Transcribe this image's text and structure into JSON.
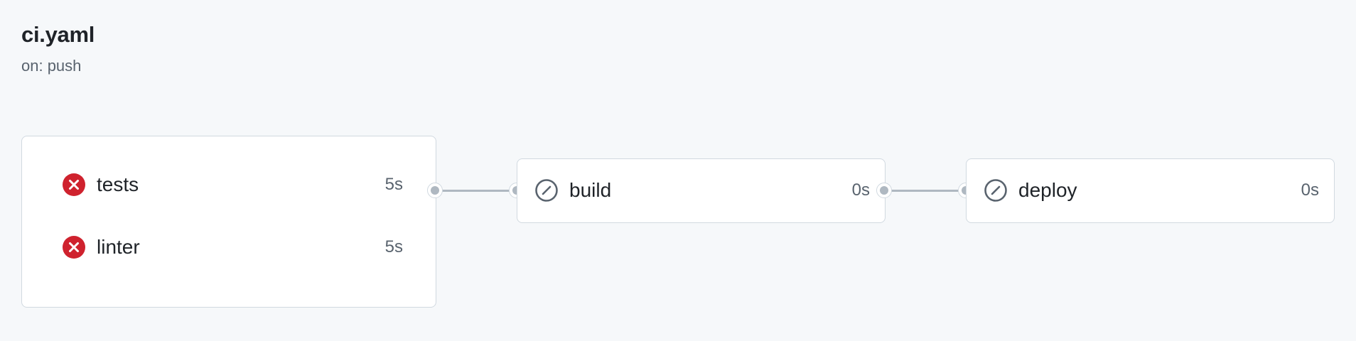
{
  "workflow": {
    "file_name": "ci.yaml",
    "trigger": "on: push"
  },
  "jobs": {
    "tests": {
      "name": "tests",
      "duration": "5s",
      "status": "failure",
      "icon": "x-circle-fill-icon"
    },
    "linter": {
      "name": "linter",
      "duration": "5s",
      "status": "failure",
      "icon": "x-circle-fill-icon"
    },
    "build": {
      "name": "build",
      "duration": "0s",
      "status": "skipped",
      "icon": "skip-icon"
    },
    "deploy": {
      "name": "deploy",
      "duration": "0s",
      "status": "skipped",
      "icon": "skip-icon"
    }
  },
  "colors": {
    "failure": "#cf222e",
    "skipped": "#59636e",
    "connector": "#afb8c1",
    "border": "#d1d9e0",
    "background": "#f6f8fa"
  }
}
